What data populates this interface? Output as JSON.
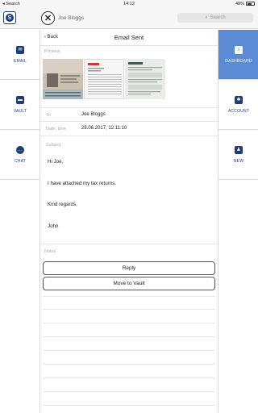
{
  "status_bar": {
    "carrier": "Search",
    "time": "14:12",
    "battery": "48%"
  },
  "header": {
    "user_name": "Joe Bloggs",
    "search_placeholder": "Search"
  },
  "left_nav": [
    {
      "label": "EMAIL",
      "icon": "envelope-icon"
    },
    {
      "label": "VAULT",
      "icon": "folder-icon"
    },
    {
      "label": "CHAT",
      "icon": "chat-icon"
    }
  ],
  "right_nav": [
    {
      "label": "DASHBOARD",
      "icon": "dashboard-icon",
      "active": true
    },
    {
      "label": "ACCOUNT",
      "icon": "gear-icon",
      "active": false
    },
    {
      "label": "NEW",
      "icon": "person-add-icon",
      "active": false
    }
  ],
  "email": {
    "back_label": "Back",
    "title": "Email Sent",
    "preview_label": "Preview",
    "to_label": "To",
    "to_value": "Joe Bloggs",
    "date_label": "Date, time",
    "date_value": "28.06.2017, 12:11:10",
    "subject_label": "Subject",
    "body": {
      "greeting": "Hi Joe,",
      "line1": "I have attached my tax returns.",
      "closing": "Kind regards,",
      "signature": "John"
    },
    "notes_label": "Notes",
    "reply_button": "Reply",
    "move_button": "Move to Vault"
  },
  "colors": {
    "accent": "#5b8bd4",
    "brand": "#1d3c78"
  }
}
